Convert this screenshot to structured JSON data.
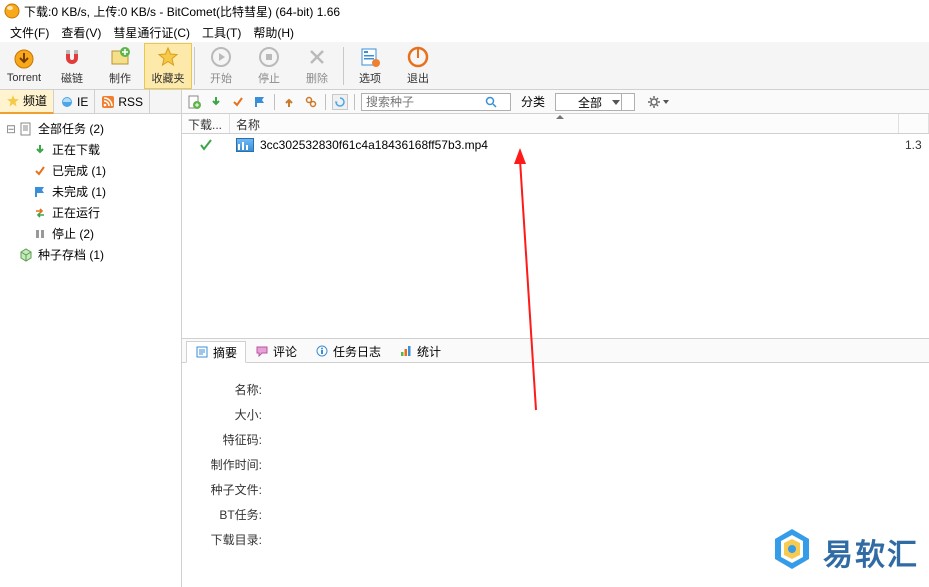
{
  "window": {
    "title": "下载:0 KB/s, 上传:0 KB/s - BitComet(比特彗星) (64-bit) 1.66"
  },
  "menu": {
    "file": "文件(F)",
    "view": "查看(V)",
    "passport": "彗星通行证(C)",
    "tools": "工具(T)",
    "help": "帮助(H)"
  },
  "toolbar": {
    "torrent": "Torrent",
    "magnet": "磁链",
    "create": "制作",
    "favorites": "收藏夹",
    "start": "开始",
    "stop": "停止",
    "delete": "删除",
    "options": "选项",
    "exit": "退出"
  },
  "left_tabs": {
    "channel": "频道",
    "ie": "IE",
    "rss": "RSS"
  },
  "tree": {
    "all_tasks": "全部任务 (2)",
    "downloading": "正在下载",
    "completed": "已完成 (1)",
    "incomplete": "未完成 (1)",
    "running": "正在运行",
    "stopped": "停止 (2)",
    "seed_archive": "种子存档 (1)"
  },
  "right_toolbar": {
    "search_placeholder": "搜索种子",
    "category_label": "分类",
    "category_value": "全部"
  },
  "list": {
    "col_download": "下载...",
    "col_name": "名称",
    "rows": [
      {
        "name": "3cc302532830f61c4a18436168ff57b3.mp4",
        "size": "1.3"
      }
    ]
  },
  "detail_tabs": {
    "summary": "摘要",
    "comments": "评论",
    "log": "任务日志",
    "stats": "统计"
  },
  "details": {
    "name_label": "名称:",
    "size_label": "大小:",
    "hash_label": "特征码:",
    "created_label": "制作时间:",
    "seed_file_label": "种子文件:",
    "bt_task_label": "BT任务:",
    "download_dir_label": "下载目录:"
  },
  "watermark": {
    "text": "易软汇"
  }
}
